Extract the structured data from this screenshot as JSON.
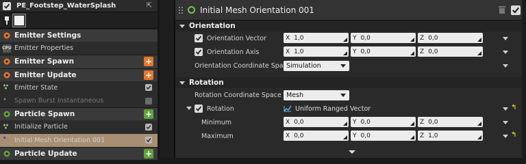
{
  "colors": {
    "accent_orange": "#e8752a",
    "accent_green": "#5fa33a",
    "selected_row": "#a88f73",
    "module_ring": "#7cc24a",
    "reset_arrow": "#e5c030"
  },
  "left": {
    "title": "PE_Footstep_WaterSplash",
    "rows": [
      {
        "kind": "header",
        "label": "Emitter Settings",
        "icon": "emitter-settings-icon",
        "icon_color": "#e8752a",
        "action": "none"
      },
      {
        "kind": "item",
        "label": "Emitter Properties",
        "icon": "cpu-icon",
        "icon_text": "CPU",
        "action": "none"
      },
      {
        "kind": "header",
        "label": "Emitter Spawn",
        "icon": "emitter-spawn-icon",
        "icon_color": "#e8752a",
        "action": "orange"
      },
      {
        "kind": "header",
        "label": "Emitter Update",
        "icon": "emitter-update-icon",
        "icon_color": "#e8752a",
        "action": "orange"
      },
      {
        "kind": "item",
        "label": "Emitter State",
        "icon": "state-dots-icon",
        "action": "check"
      },
      {
        "kind": "item",
        "label": "Spawn Burst Instantaneous",
        "icon": "dot-icon",
        "action": "check-off",
        "disabled": true
      },
      {
        "kind": "header",
        "label": "Particle Spawn",
        "icon": "particle-spawn-icon",
        "icon_color": "#5fa33a",
        "action": "green"
      },
      {
        "kind": "item",
        "label": "Initialize Particle",
        "icon": "init-dots-icon",
        "action": "check"
      },
      {
        "kind": "item",
        "label": "Initial Mesh Orientation 001",
        "icon": "mesh-dot-icon",
        "action": "check",
        "selected": true
      },
      {
        "kind": "header",
        "label": "Particle Update",
        "icon": "particle-update-icon",
        "icon_color": "#5fa33a",
        "action": "green"
      }
    ]
  },
  "right": {
    "title": "Initial Mesh Orientation 001",
    "sections": {
      "orientation": "Orientation",
      "rotation": "Rotation"
    },
    "orientation_vector": {
      "label": "Orientation Vector",
      "x": "1,0",
      "y": "0,0",
      "z": "0,0"
    },
    "orientation_axis": {
      "label": "Orientation Axis",
      "x": "1,0",
      "y": "0,0",
      "z": "0,0"
    },
    "orientation_space": {
      "label": "Orientation Coordinate Spac",
      "value": "Simulation"
    },
    "rotation_space": {
      "label": "Rotation Coordinate Space",
      "value": "Mesh"
    },
    "rotation": {
      "label": "Rotation",
      "value": "Uniform Ranged Vector"
    },
    "minimum": {
      "label": "Minimum",
      "x": "0,0",
      "y": "0,0",
      "z": "0,0"
    },
    "maximum": {
      "label": "Maximum",
      "x": "0,0",
      "y": "0,0",
      "z": "1,0"
    },
    "axis_labels": {
      "x": "X",
      "y": "Y",
      "z": "Z"
    },
    "reset_glyph": "↰"
  }
}
